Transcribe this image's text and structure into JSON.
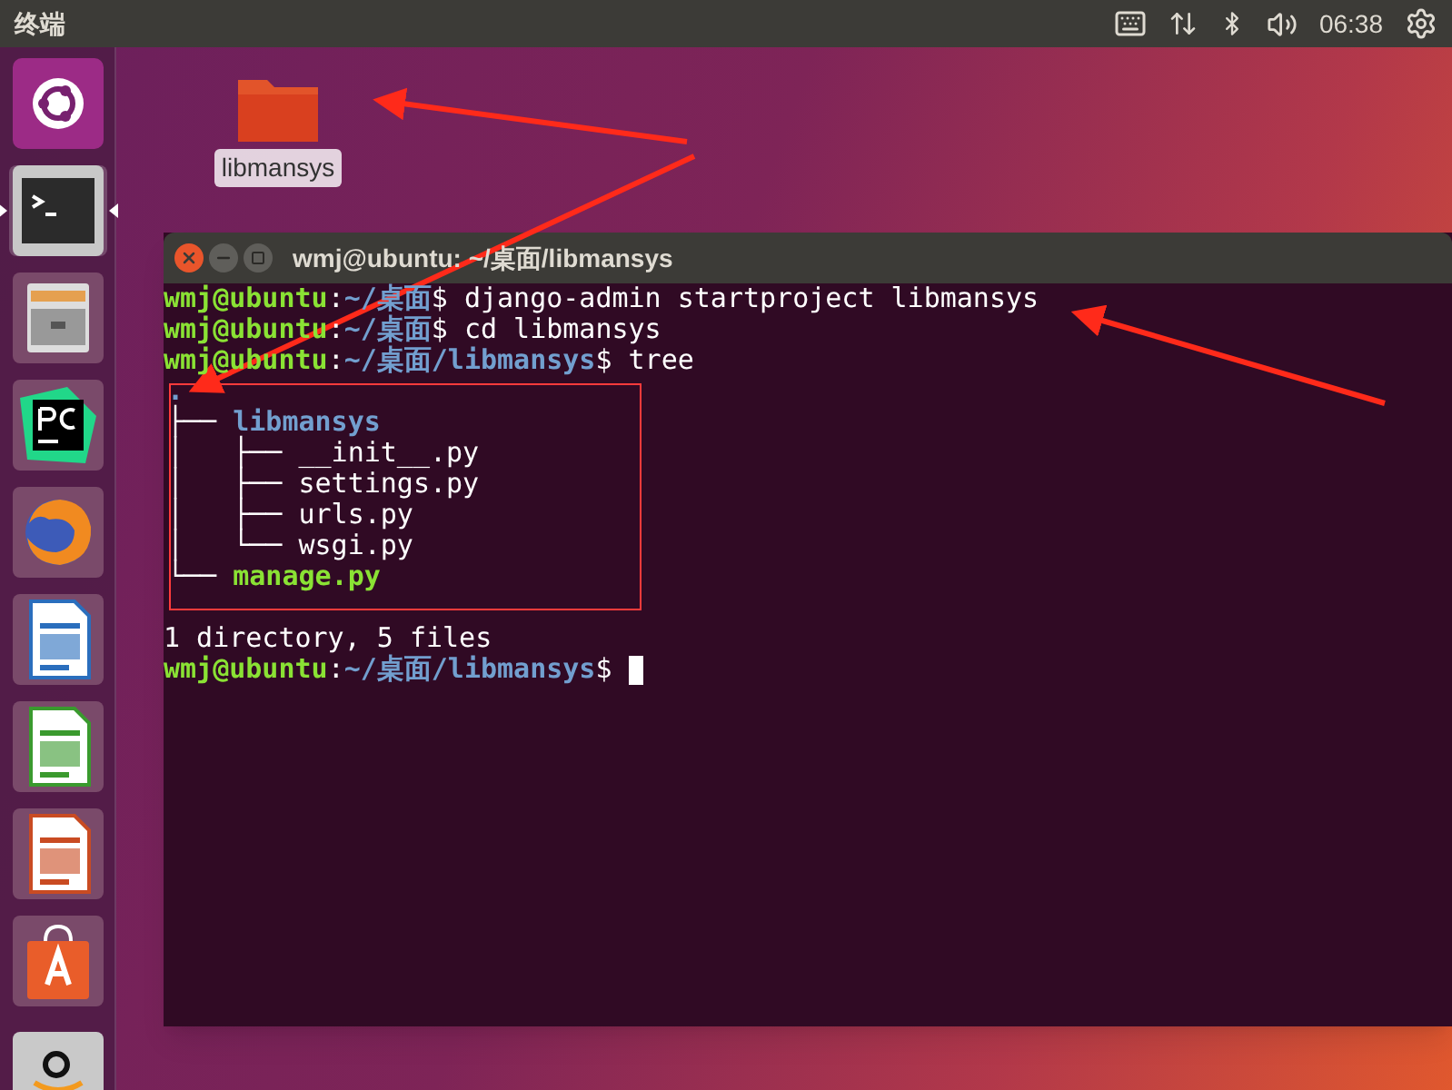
{
  "top_bar": {
    "title": "终端",
    "clock": "06:38"
  },
  "launcher": {
    "items": [
      {
        "kind": "ubuntu",
        "selected": false
      },
      {
        "kind": "terminal",
        "selected": true
      },
      {
        "kind": "files",
        "selected": false
      },
      {
        "kind": "ide",
        "selected": false
      },
      {
        "kind": "browser",
        "selected": false
      },
      {
        "kind": "writer",
        "selected": false
      },
      {
        "kind": "calc",
        "selected": false
      },
      {
        "kind": "impress",
        "selected": false
      },
      {
        "kind": "store",
        "selected": false
      },
      {
        "kind": "amazon",
        "selected": false
      }
    ]
  },
  "desktop_icons": [
    {
      "label": "libmansys"
    }
  ],
  "terminal": {
    "title": "wmj@ubuntu: ~/桌面/libmansys",
    "lines": [
      {
        "kind": "prompt",
        "segments": [
          {
            "text": "wmj@ubuntu",
            "kind": "user"
          },
          {
            "text": ":",
            "kind": "plain"
          },
          {
            "text": "~/桌面",
            "kind": "path"
          },
          {
            "text": "$ django-admin startproject libmansys",
            "kind": "plain"
          }
        ]
      },
      {
        "kind": "prompt",
        "segments": [
          {
            "text": "wmj@ubuntu",
            "kind": "user"
          },
          {
            "text": ":",
            "kind": "plain"
          },
          {
            "text": "~/桌面",
            "kind": "path"
          },
          {
            "text": "$ cd libmansys",
            "kind": "plain"
          }
        ]
      },
      {
        "kind": "prompt",
        "segments": [
          {
            "text": "wmj@ubuntu",
            "kind": "user"
          },
          {
            "text": ":",
            "kind": "plain"
          },
          {
            "text": "~/桌面/libmansys",
            "kind": "path"
          },
          {
            "text": "$ tree",
            "kind": "plain"
          }
        ]
      },
      {
        "kind": "tree",
        "segments": [
          {
            "text": ".",
            "kind": "dir"
          }
        ]
      },
      {
        "kind": "tree",
        "segments": [
          {
            "text": "├── ",
            "kind": "plain"
          },
          {
            "text": "libmansys",
            "kind": "dir"
          }
        ]
      },
      {
        "kind": "tree",
        "segments": [
          {
            "text": "│   ├── __init__.py",
            "kind": "plain"
          }
        ]
      },
      {
        "kind": "tree",
        "segments": [
          {
            "text": "│   ├── settings.py",
            "kind": "plain"
          }
        ]
      },
      {
        "kind": "tree",
        "segments": [
          {
            "text": "│   ├── urls.py",
            "kind": "plain"
          }
        ]
      },
      {
        "kind": "tree",
        "segments": [
          {
            "text": "│   └── wsgi.py",
            "kind": "plain"
          }
        ]
      },
      {
        "kind": "tree",
        "segments": [
          {
            "text": "└── ",
            "kind": "plain"
          },
          {
            "text": "manage.py",
            "kind": "exe"
          }
        ]
      },
      {
        "kind": "output",
        "segments": [
          {
            "text": "1 directory, 5 files",
            "kind": "plain"
          }
        ]
      },
      {
        "kind": "prompt",
        "cursor": true,
        "segments": [
          {
            "text": "wmj@ubuntu",
            "kind": "user"
          },
          {
            "text": ":",
            "kind": "plain"
          },
          {
            "text": "~/桌面/libmansys",
            "kind": "path"
          },
          {
            "text": "$ ",
            "kind": "plain"
          }
        ]
      }
    ]
  }
}
